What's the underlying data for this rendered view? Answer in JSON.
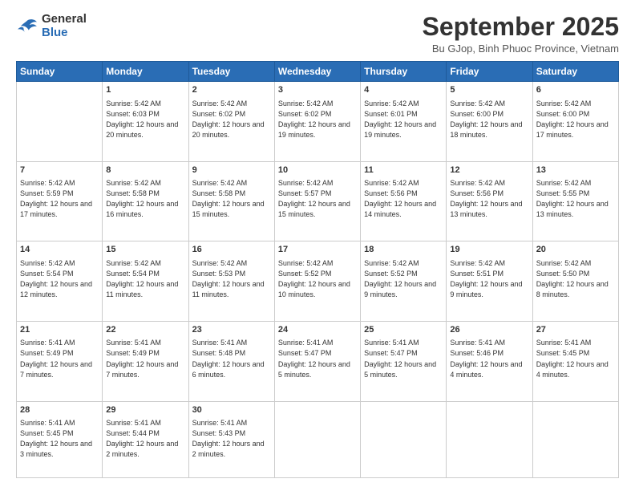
{
  "logo": {
    "line1": "General",
    "line2": "Blue"
  },
  "header": {
    "title": "September 2025",
    "subtitle": "Bu GJop, Binh Phuoc Province, Vietnam"
  },
  "weekdays": [
    "Sunday",
    "Monday",
    "Tuesday",
    "Wednesday",
    "Thursday",
    "Friday",
    "Saturday"
  ],
  "weeks": [
    [
      {
        "day": "",
        "sunrise": "",
        "sunset": "",
        "daylight": ""
      },
      {
        "day": "1",
        "sunrise": "Sunrise: 5:42 AM",
        "sunset": "Sunset: 6:03 PM",
        "daylight": "Daylight: 12 hours and 20 minutes."
      },
      {
        "day": "2",
        "sunrise": "Sunrise: 5:42 AM",
        "sunset": "Sunset: 6:02 PM",
        "daylight": "Daylight: 12 hours and 20 minutes."
      },
      {
        "day": "3",
        "sunrise": "Sunrise: 5:42 AM",
        "sunset": "Sunset: 6:02 PM",
        "daylight": "Daylight: 12 hours and 19 minutes."
      },
      {
        "day": "4",
        "sunrise": "Sunrise: 5:42 AM",
        "sunset": "Sunset: 6:01 PM",
        "daylight": "Daylight: 12 hours and 19 minutes."
      },
      {
        "day": "5",
        "sunrise": "Sunrise: 5:42 AM",
        "sunset": "Sunset: 6:00 PM",
        "daylight": "Daylight: 12 hours and 18 minutes."
      },
      {
        "day": "6",
        "sunrise": "Sunrise: 5:42 AM",
        "sunset": "Sunset: 6:00 PM",
        "daylight": "Daylight: 12 hours and 17 minutes."
      }
    ],
    [
      {
        "day": "7",
        "sunrise": "Sunrise: 5:42 AM",
        "sunset": "Sunset: 5:59 PM",
        "daylight": "Daylight: 12 hours and 17 minutes."
      },
      {
        "day": "8",
        "sunrise": "Sunrise: 5:42 AM",
        "sunset": "Sunset: 5:58 PM",
        "daylight": "Daylight: 12 hours and 16 minutes."
      },
      {
        "day": "9",
        "sunrise": "Sunrise: 5:42 AM",
        "sunset": "Sunset: 5:58 PM",
        "daylight": "Daylight: 12 hours and 15 minutes."
      },
      {
        "day": "10",
        "sunrise": "Sunrise: 5:42 AM",
        "sunset": "Sunset: 5:57 PM",
        "daylight": "Daylight: 12 hours and 15 minutes."
      },
      {
        "day": "11",
        "sunrise": "Sunrise: 5:42 AM",
        "sunset": "Sunset: 5:56 PM",
        "daylight": "Daylight: 12 hours and 14 minutes."
      },
      {
        "day": "12",
        "sunrise": "Sunrise: 5:42 AM",
        "sunset": "Sunset: 5:56 PM",
        "daylight": "Daylight: 12 hours and 13 minutes."
      },
      {
        "day": "13",
        "sunrise": "Sunrise: 5:42 AM",
        "sunset": "Sunset: 5:55 PM",
        "daylight": "Daylight: 12 hours and 13 minutes."
      }
    ],
    [
      {
        "day": "14",
        "sunrise": "Sunrise: 5:42 AM",
        "sunset": "Sunset: 5:54 PM",
        "daylight": "Daylight: 12 hours and 12 minutes."
      },
      {
        "day": "15",
        "sunrise": "Sunrise: 5:42 AM",
        "sunset": "Sunset: 5:54 PM",
        "daylight": "Daylight: 12 hours and 11 minutes."
      },
      {
        "day": "16",
        "sunrise": "Sunrise: 5:42 AM",
        "sunset": "Sunset: 5:53 PM",
        "daylight": "Daylight: 12 hours and 11 minutes."
      },
      {
        "day": "17",
        "sunrise": "Sunrise: 5:42 AM",
        "sunset": "Sunset: 5:52 PM",
        "daylight": "Daylight: 12 hours and 10 minutes."
      },
      {
        "day": "18",
        "sunrise": "Sunrise: 5:42 AM",
        "sunset": "Sunset: 5:52 PM",
        "daylight": "Daylight: 12 hours and 9 minutes."
      },
      {
        "day": "19",
        "sunrise": "Sunrise: 5:42 AM",
        "sunset": "Sunset: 5:51 PM",
        "daylight": "Daylight: 12 hours and 9 minutes."
      },
      {
        "day": "20",
        "sunrise": "Sunrise: 5:42 AM",
        "sunset": "Sunset: 5:50 PM",
        "daylight": "Daylight: 12 hours and 8 minutes."
      }
    ],
    [
      {
        "day": "21",
        "sunrise": "Sunrise: 5:41 AM",
        "sunset": "Sunset: 5:49 PM",
        "daylight": "Daylight: 12 hours and 7 minutes."
      },
      {
        "day": "22",
        "sunrise": "Sunrise: 5:41 AM",
        "sunset": "Sunset: 5:49 PM",
        "daylight": "Daylight: 12 hours and 7 minutes."
      },
      {
        "day": "23",
        "sunrise": "Sunrise: 5:41 AM",
        "sunset": "Sunset: 5:48 PM",
        "daylight": "Daylight: 12 hours and 6 minutes."
      },
      {
        "day": "24",
        "sunrise": "Sunrise: 5:41 AM",
        "sunset": "Sunset: 5:47 PM",
        "daylight": "Daylight: 12 hours and 5 minutes."
      },
      {
        "day": "25",
        "sunrise": "Sunrise: 5:41 AM",
        "sunset": "Sunset: 5:47 PM",
        "daylight": "Daylight: 12 hours and 5 minutes."
      },
      {
        "day": "26",
        "sunrise": "Sunrise: 5:41 AM",
        "sunset": "Sunset: 5:46 PM",
        "daylight": "Daylight: 12 hours and 4 minutes."
      },
      {
        "day": "27",
        "sunrise": "Sunrise: 5:41 AM",
        "sunset": "Sunset: 5:45 PM",
        "daylight": "Daylight: 12 hours and 4 minutes."
      }
    ],
    [
      {
        "day": "28",
        "sunrise": "Sunrise: 5:41 AM",
        "sunset": "Sunset: 5:45 PM",
        "daylight": "Daylight: 12 hours and 3 minutes."
      },
      {
        "day": "29",
        "sunrise": "Sunrise: 5:41 AM",
        "sunset": "Sunset: 5:44 PM",
        "daylight": "Daylight: 12 hours and 2 minutes."
      },
      {
        "day": "30",
        "sunrise": "Sunrise: 5:41 AM",
        "sunset": "Sunset: 5:43 PM",
        "daylight": "Daylight: 12 hours and 2 minutes."
      },
      {
        "day": "",
        "sunrise": "",
        "sunset": "",
        "daylight": ""
      },
      {
        "day": "",
        "sunrise": "",
        "sunset": "",
        "daylight": ""
      },
      {
        "day": "",
        "sunrise": "",
        "sunset": "",
        "daylight": ""
      },
      {
        "day": "",
        "sunrise": "",
        "sunset": "",
        "daylight": ""
      }
    ]
  ]
}
